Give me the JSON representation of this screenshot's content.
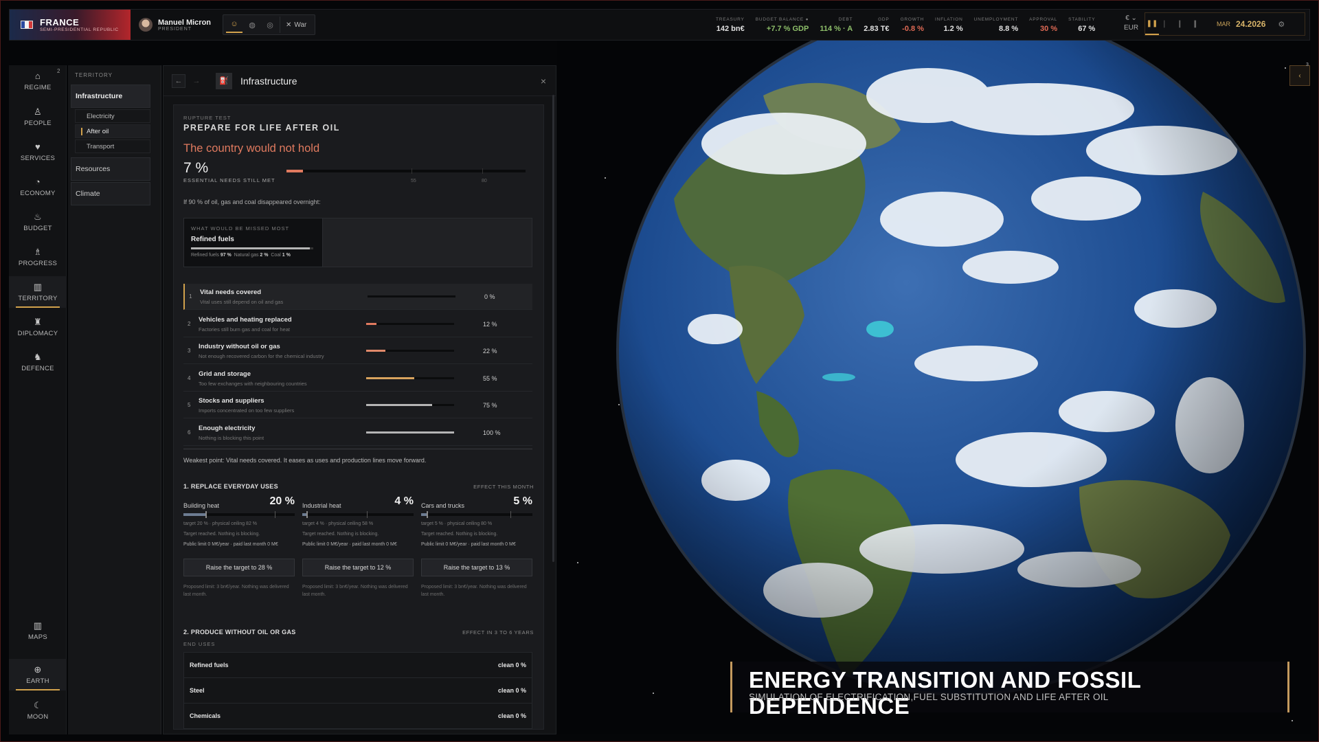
{
  "topbar": {
    "country": "FRANCE",
    "regime": "SEMI-PRESIDENTIAL REPUBLIC",
    "leader_name": "Manuel Micron",
    "leader_title": "PRESIDENT",
    "war_label": "War",
    "stats": [
      {
        "key": "TREASURY",
        "value": "142 bn€",
        "tone": ""
      },
      {
        "key": "BUDGET BALANCE ●",
        "value": "+7.7 % GDP",
        "tone": "g"
      },
      {
        "key": "DEBT",
        "value": "114 % · A",
        "tone": "g"
      },
      {
        "key": "GDP",
        "value": "2.83 T€",
        "tone": ""
      },
      {
        "key": "GROWTH",
        "value": "-0.8 %",
        "tone": "r"
      },
      {
        "key": "INFLATION",
        "value": "1.2 %",
        "tone": ""
      },
      {
        "key": "UNEMPLOYMENT",
        "value": "8.8 %",
        "tone": ""
      },
      {
        "key": "APPROVAL",
        "value": "30 %",
        "tone": "r"
      },
      {
        "key": "STABILITY",
        "value": "67 %",
        "tone": ""
      }
    ],
    "currency_symbol": "€ ⌄",
    "currency": "EUR",
    "month": "MAR",
    "date": "24.2026"
  },
  "nav": {
    "badge": "2",
    "items": [
      {
        "label": "REGIME",
        "icon": "⌂"
      },
      {
        "label": "PEOPLE",
        "icon": "♙"
      },
      {
        "label": "SERVICES",
        "icon": "♥"
      },
      {
        "label": "ECONOMY",
        "icon": "◔"
      },
      {
        "label": "BUDGET",
        "icon": "♨"
      },
      {
        "label": "PROGRESS",
        "icon": "♗"
      },
      {
        "label": "TERRITORY",
        "icon": "▥"
      },
      {
        "label": "DIPLOMACY",
        "icon": "♜"
      },
      {
        "label": "DEFENCE",
        "icon": "♞"
      }
    ],
    "bottom": [
      {
        "label": "MAPS",
        "icon": "▥"
      },
      {
        "label": "EARTH",
        "icon": "⊕"
      },
      {
        "label": "MOON",
        "icon": "☾"
      }
    ]
  },
  "territory": {
    "heading": "TERRITORY",
    "infrastructure": "Infrastructure",
    "subs": [
      "Electricity",
      "After oil",
      "Transport"
    ],
    "resources": "Resources",
    "climate": "Climate"
  },
  "panel": {
    "title": "Infrastructure",
    "close": "×",
    "test_label": "RUPTURE TEST",
    "test_title": "PREPARE FOR LIFE AFTER OIL",
    "verdict": "The country would not hold",
    "percent": "7 %",
    "percent_value": 7,
    "percent_label": "ESSENTIAL NEEDS STILL MET",
    "tick_a": "55",
    "tick_b": "80",
    "question": "If 90 % of oil, gas and coal disappeared overnight:",
    "missed_label": "WHAT WOULD BE MISSED MOST",
    "missed_title": "Refined fuels",
    "missed_share": 97,
    "missed_f1": "Refined fuels",
    "missed_v1": "97 %",
    "missed_f2": "Natural gas",
    "missed_v2": "2 %",
    "missed_f3": "Coal",
    "missed_v3": "1 %",
    "rows": [
      {
        "n": "1",
        "title": "Vital needs covered",
        "desc": "Vital uses still depend on oil and gas",
        "pct": "0 %",
        "value": 0,
        "color": "#e07a5f"
      },
      {
        "n": "2",
        "title": "Vehicles and heating replaced",
        "desc": "Factories still burn gas and coal for heat",
        "pct": "12 %",
        "value": 12,
        "color": "#e07a5f"
      },
      {
        "n": "3",
        "title": "Industry without oil or gas",
        "desc": "Not enough recovered carbon for the chemical industry",
        "pct": "22 %",
        "value": 22,
        "color": "#e0896a"
      },
      {
        "n": "4",
        "title": "Grid and storage",
        "desc": "Too few exchanges with neighbouring countries",
        "pct": "55 %",
        "value": 55,
        "color": "#d9a35e"
      },
      {
        "n": "5",
        "title": "Stocks and suppliers",
        "desc": "Imports concentrated on too few suppliers",
        "pct": "75 %",
        "value": 75,
        "color": "#b5b5b5"
      },
      {
        "n": "6",
        "title": "Enough electricity",
        "desc": "Nothing is blocking this point",
        "pct": "100 %",
        "value": 100,
        "color": "#b5b5b5"
      }
    ],
    "weak": "Weakest point: Vital needs covered. It eases as uses and production lines move forward.",
    "sec1": "1. REPLACE EVERYDAY USES",
    "sec1_hint": "EFFECT THIS MONTH",
    "uses": [
      {
        "name": "Building heat",
        "pct": "20 %",
        "value": 20,
        "ceiling": 82,
        "target": "target 20 % · physical ceiling 82 %",
        "status": "Target reached. Nothing is blocking.",
        "limit": "Public limit 0 M€/year · paid last month 0 M€",
        "button": "Raise the target to 28 %",
        "proposed": "Proposed limit: 3 bn€/year. Nothing was delivered last month."
      },
      {
        "name": "Industrial heat",
        "pct": "4 %",
        "value": 4,
        "ceiling": 58,
        "target": "target 4 % · physical ceiling 58 %",
        "status": "Target reached. Nothing is blocking.",
        "limit": "Public limit 0 M€/year · paid last month 0 M€",
        "button": "Raise the target to 12 %",
        "proposed": "Proposed limit: 3 bn€/year. Nothing was delivered last month."
      },
      {
        "name": "Cars and trucks",
        "pct": "5 %",
        "value": 5,
        "ceiling": 80,
        "target": "target 5 % · physical ceiling 80 %",
        "status": "Target reached. Nothing is blocking.",
        "limit": "Public limit 0 M€/year · paid last month 0 M€",
        "button": "Raise the target to 13 %",
        "proposed": "Proposed limit: 3 bn€/year. Nothing was delivered last month."
      }
    ],
    "sec2": "2. PRODUCE WITHOUT OIL OR GAS",
    "sec2_hint": "EFFECT IN 3 TO 6 YEARS",
    "end_uses_label": "END USES",
    "end_uses": [
      {
        "name": "Refined fuels",
        "value": "clean 0 %"
      },
      {
        "name": "Steel",
        "value": "clean 0 %"
      },
      {
        "name": "Chemicals",
        "value": "clean 0 %"
      }
    ]
  },
  "globe": {
    "badge": "3",
    "caption_title": "ENERGY TRANSITION AND FOSSIL DEPENDENCE",
    "caption_sub": "SIMULATION OF ELECTRIFICATION,FUEL SUBSTITUTION AND LIFE AFTER OIL"
  }
}
